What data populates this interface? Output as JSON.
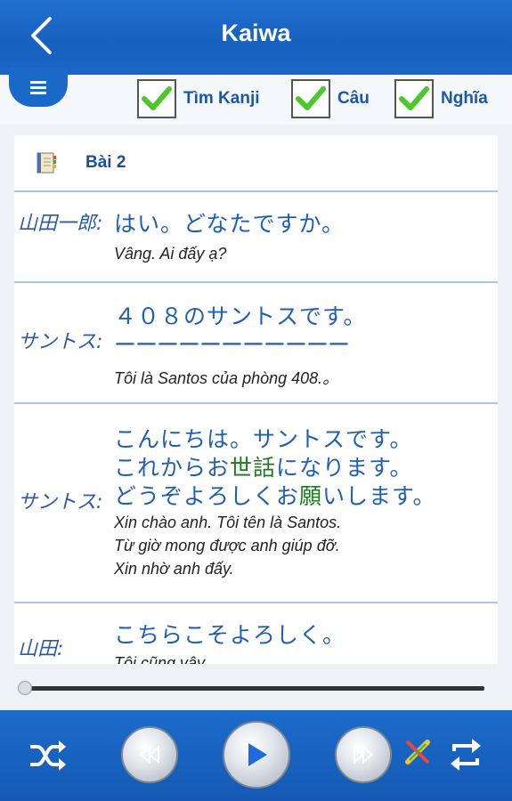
{
  "header": {
    "title": "Kaiwa"
  },
  "toolbar": {
    "checks": [
      {
        "label": "Tìm Kanji",
        "checked": true
      },
      {
        "label": "Câu",
        "checked": true
      },
      {
        "label": "Nghĩa",
        "checked": true
      }
    ]
  },
  "lesson": {
    "title": "Bài 2"
  },
  "dialog": [
    {
      "speaker": "山田一郎:",
      "jp": [
        "はい。どなたですか。"
      ],
      "vi": [
        "Vâng. Ai đấy ạ?"
      ]
    },
    {
      "speaker": "サントス:",
      "jp": [
        "４０８のサントスです。",
        "ーーーーーーーーーーー"
      ],
      "vi": [
        "Tôi là Santos của phòng 408.。"
      ]
    },
    {
      "speaker": "サントス:",
      "jp_parts": {
        "l1": "こんにちは。サントスです。",
        "l2a": "これからお",
        "l2b": "世話",
        "l2c": "になります。",
        "l3a": "どうぞよろしくお",
        "l3b": "願",
        "l3c": "いします。"
      },
      "vi": [
        "Xin chào anh. Tôi tên là Santos.",
        "Từ giờ mong được anh giúp đỡ.",
        "Xin nhờ anh đấy."
      ]
    },
    {
      "speaker": "山田:",
      "jp": [
        "こちらこそよろしく。"
      ],
      "vi": [
        "Tôi cũng vậy..."
      ]
    }
  ],
  "player": {
    "progress": 0.0,
    "icons": [
      "shuffle-icon",
      "rewind-icon",
      "play-icon",
      "fast-forward-icon",
      "pencil-icon",
      "repeat-icon"
    ]
  },
  "colors": {
    "accent": "#1a66c6",
    "text_blue": "#1f5fb3",
    "highlight_green": "#1f7a1f"
  }
}
